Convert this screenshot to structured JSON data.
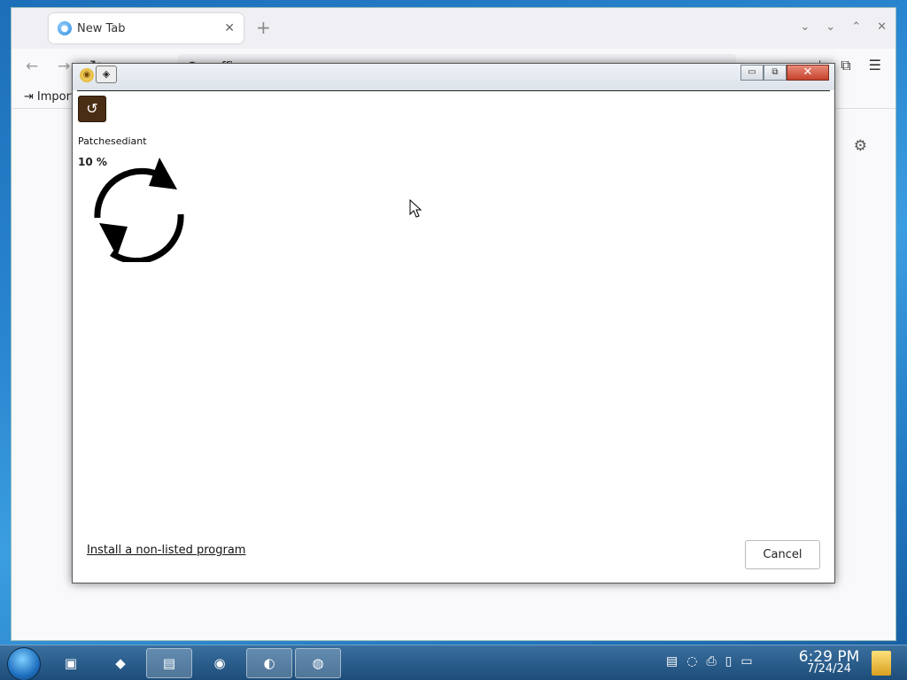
{
  "browser": {
    "tab_title": "New Tab",
    "tab_close": "✕",
    "new_tab": "+",
    "url_text": "office",
    "bookmark_label": "Import",
    "tab_controls": [
      "⌄",
      "⌄",
      "⌃",
      "✕"
    ]
  },
  "dialog": {
    "status_label": "Patchesediant",
    "progress_text": "10 %",
    "progress_fraction": 0.1,
    "install_link": "Install a non-listed program",
    "cancel_label": "Cancel",
    "title_buttons": {
      "minimize": "▭",
      "maximize": "⧉",
      "close": "✕"
    }
  },
  "taskbar": {
    "time": "6:29 PM",
    "date": "7/24/24"
  }
}
